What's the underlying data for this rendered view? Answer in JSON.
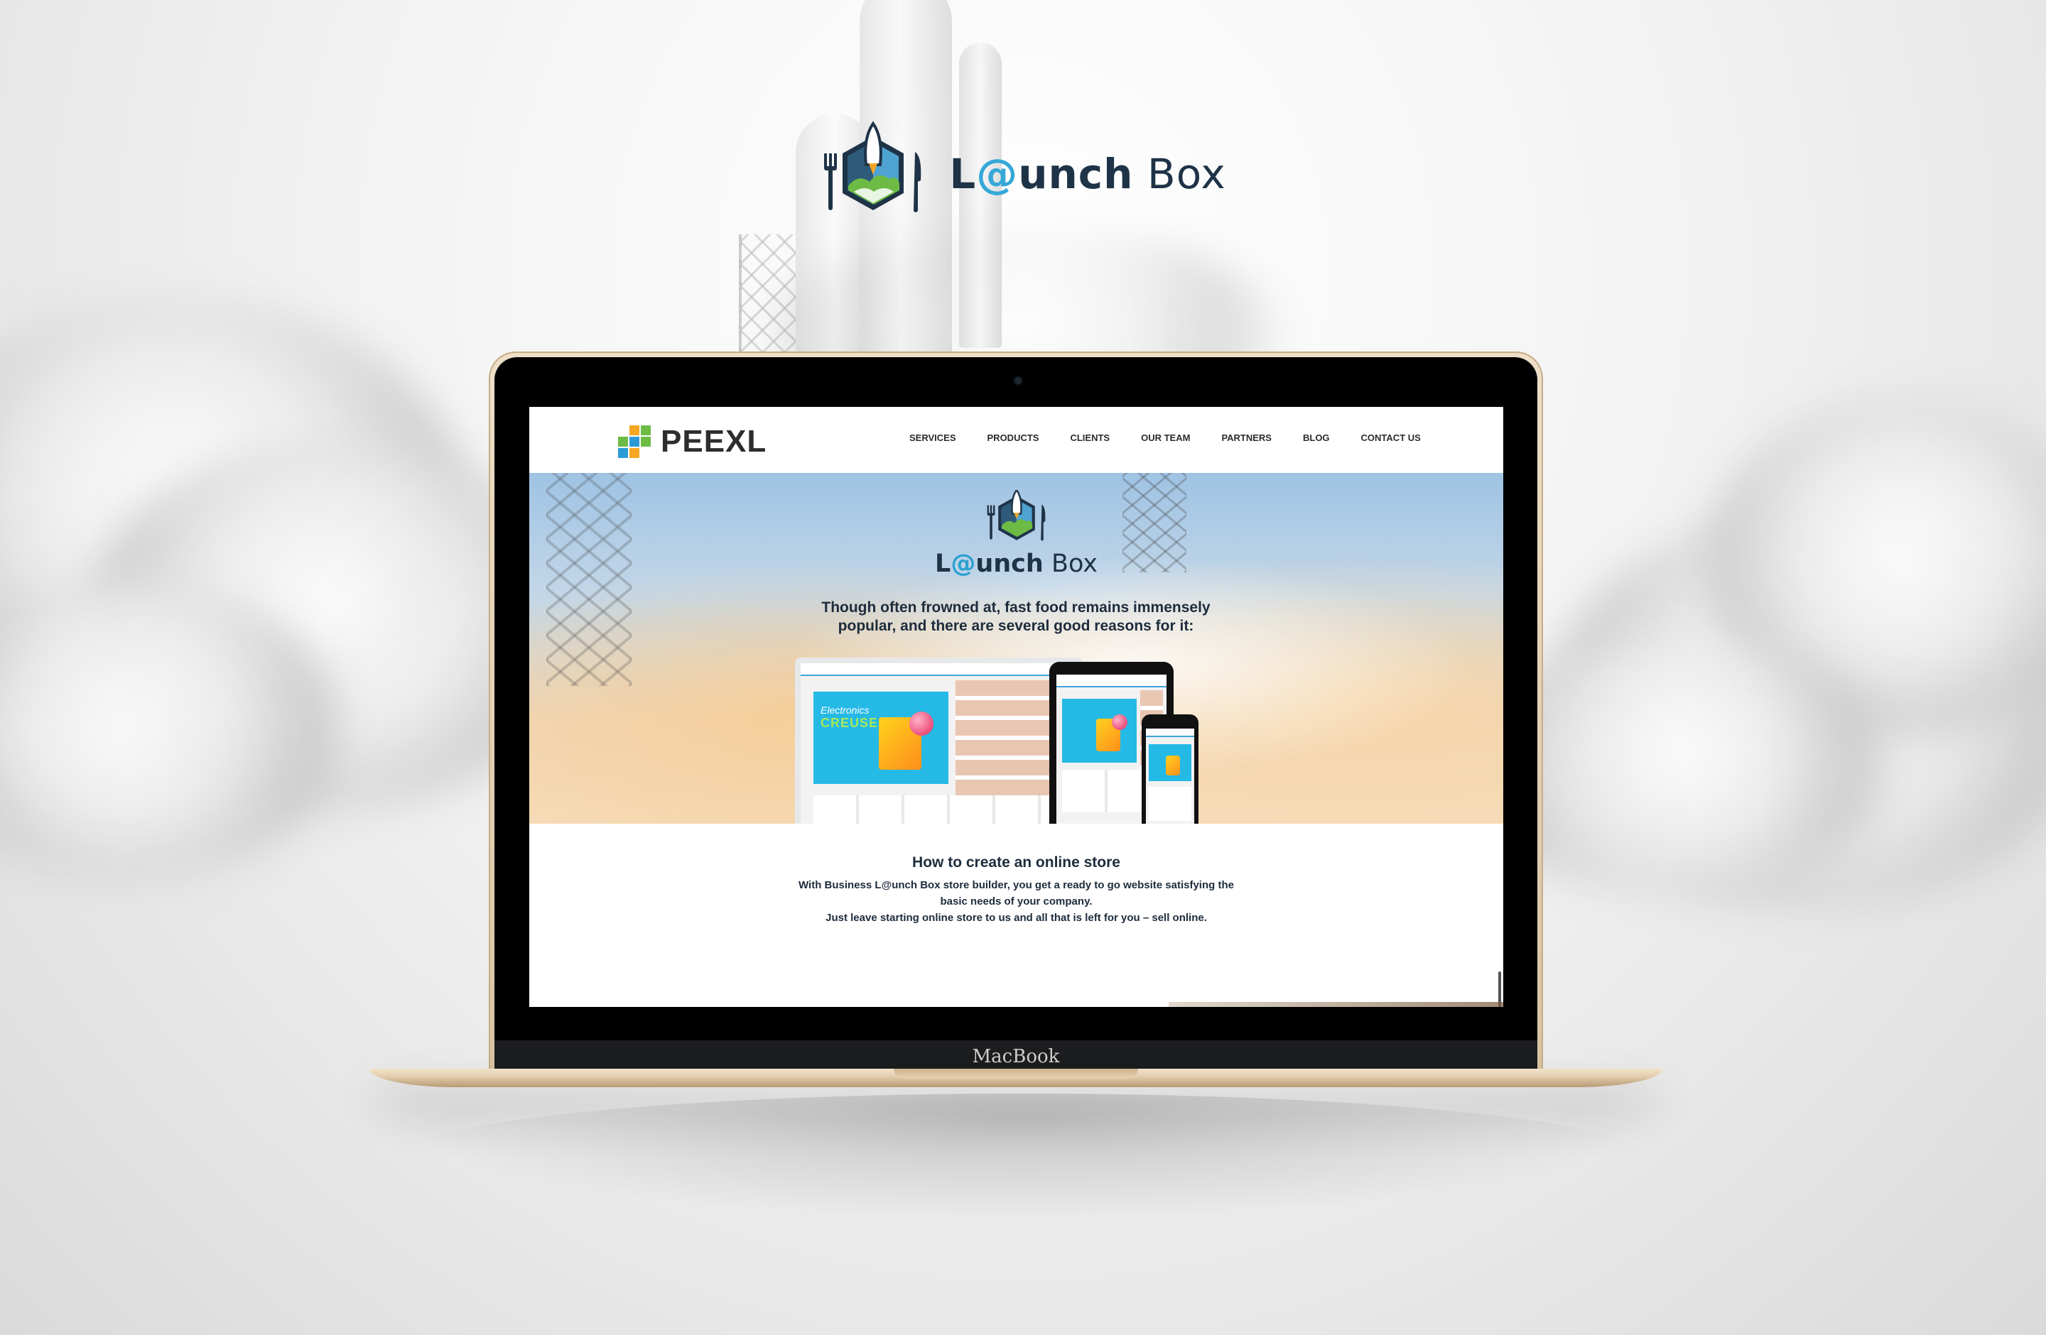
{
  "brand": {
    "name_prefix": "L",
    "name_at": "@",
    "name_unch": "unch",
    "name_box": " Box",
    "logo_icon": "launch-box-rocket-icon"
  },
  "device": {
    "label": "MacBook"
  },
  "site": {
    "logo_text": "PEEXL",
    "logo_icon": "peexl-squares-icon",
    "nav": [
      {
        "label": "SERVICES"
      },
      {
        "label": "PRODUCTS"
      },
      {
        "label": "CLIENTS"
      },
      {
        "label": "OUR TEAM"
      },
      {
        "label": "PARTNERS"
      },
      {
        "label": "BLOG"
      },
      {
        "label": "CONTACT US"
      }
    ],
    "hero": {
      "tagline_line1": "Though often frowned at, fast food remains immensely",
      "tagline_line2": "popular, and there are several good reasons for it:",
      "mockup_banner_line1": "Electronics",
      "mockup_banner_line2": "CREUSE"
    },
    "about": {
      "title": "How to create an online store",
      "line1": "With Business L@unch Box store builder, you get a ready to go website satisfying the",
      "line2": "basic needs of your company.",
      "line3": "Just leave starting online store to us and all that is left for you – sell online."
    }
  },
  "colors": {
    "brand_dark": "#1f3347",
    "brand_accent": "#35a8d8",
    "peexl_green": "#6dbb45",
    "peexl_blue": "#2a9bd6",
    "peexl_orange": "#f5a623",
    "gold": "#e2cbaa"
  }
}
